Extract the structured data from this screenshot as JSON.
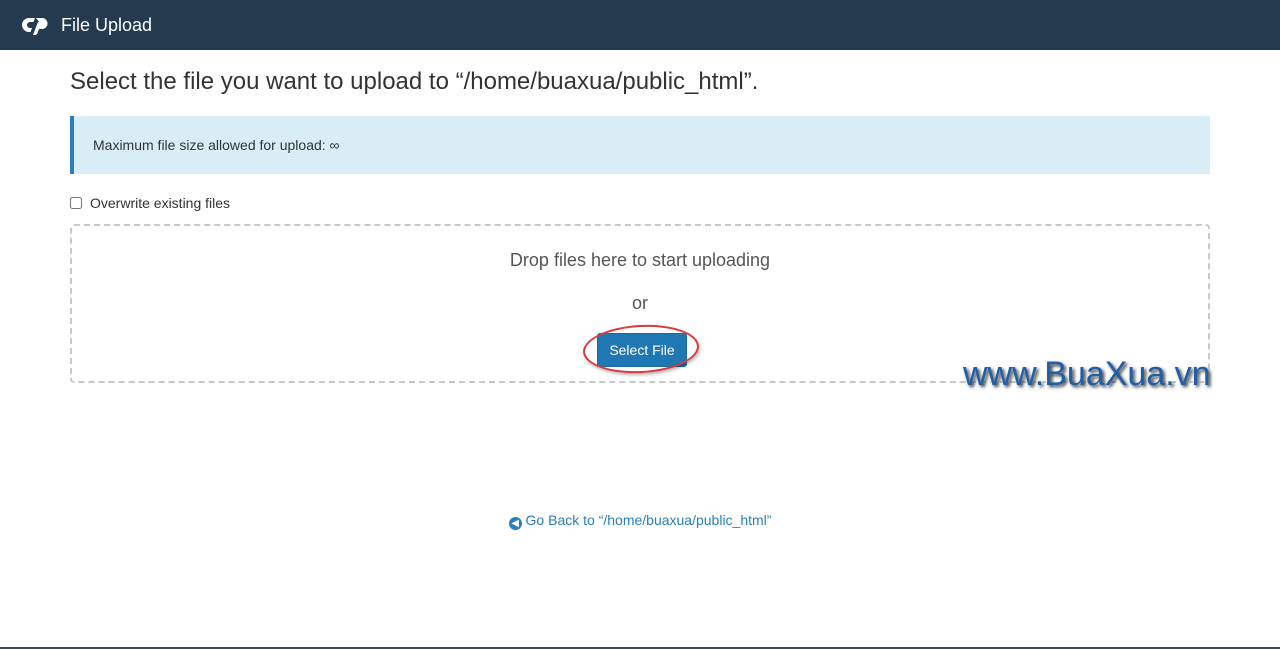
{
  "header": {
    "title": "File Upload",
    "background": "#243a4f"
  },
  "main": {
    "heading": "Select the file you want to upload to “/home/buaxua/public_html”.",
    "info_alert": "Maximum file size allowed for upload: ∞",
    "overwrite_label": "Overwrite existing files",
    "overwrite_checked": false,
    "dropzone": {
      "drop_text": "Drop files here to start uploading",
      "or_text": "or",
      "select_button": "Select File"
    },
    "back_link": "Go Back to “/home/buaxua/public_html”"
  },
  "watermark": "www.BuaXua.vn",
  "colors": {
    "accent": "#1f78b4",
    "alert_bg": "#d9edf7",
    "alert_border": "#2a7fb8",
    "highlight_ring": "#d93a3a"
  },
  "icons": {
    "logo": "cpanel-logo-icon",
    "back": "circle-arrow-left-icon"
  }
}
